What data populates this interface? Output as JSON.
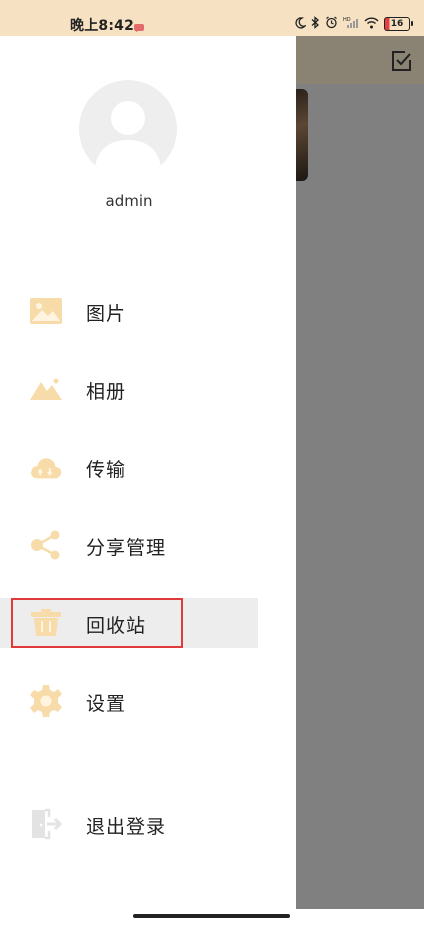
{
  "status_bar": {
    "time": "晚上8:42",
    "icons": [
      "message-icon",
      "moon-icon",
      "bluetooth-icon",
      "alarm-icon",
      "signal-icon",
      "wifi-icon",
      "battery-icon"
    ],
    "battery_level": "16"
  },
  "drawer": {
    "username": "admin",
    "items": [
      {
        "label": "图片",
        "icon": "image-icon"
      },
      {
        "label": "相册",
        "icon": "album-icon"
      },
      {
        "label": "传输",
        "icon": "cloud-transfer-icon"
      },
      {
        "label": "分享管理",
        "icon": "share-icon"
      },
      {
        "label": "回收站",
        "icon": "trash-icon"
      },
      {
        "label": "设置",
        "icon": "gear-icon"
      },
      {
        "label": "退出登录",
        "icon": "logout-icon"
      }
    ],
    "active_item": "回收站"
  },
  "colors": {
    "status_bar_bg": "#f6e2c2",
    "icon_accent": "#f6d8a3",
    "highlight_border": "#e03a3a",
    "overlay_gray": "#808080"
  }
}
